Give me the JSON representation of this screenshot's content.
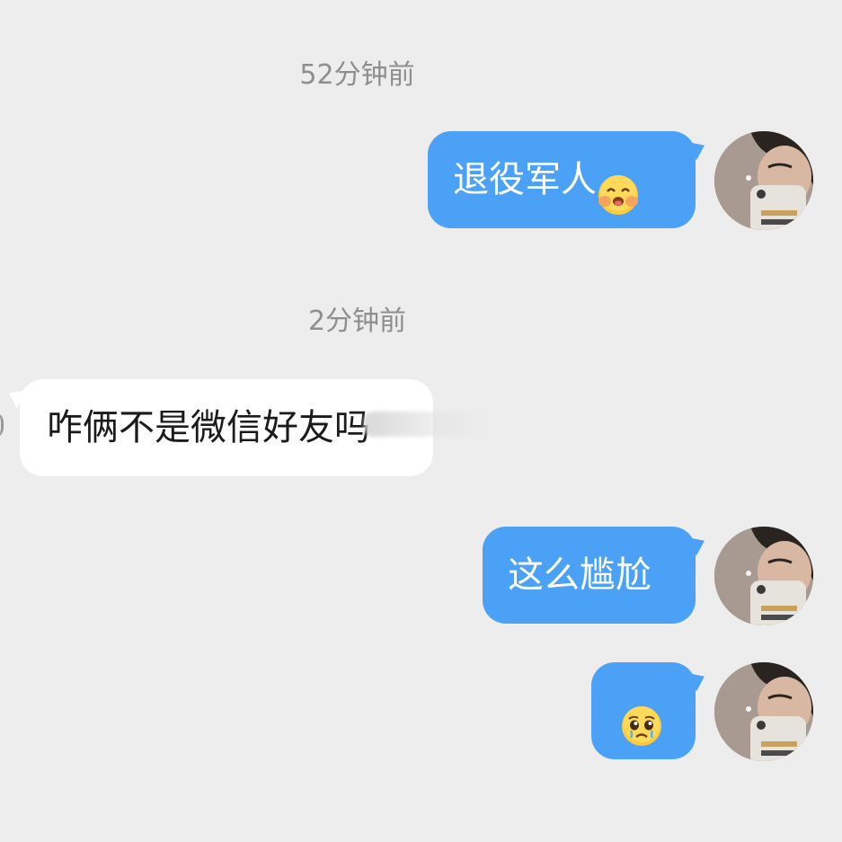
{
  "messages": [
    {
      "kind": "timestamp",
      "text": "52分钟前"
    },
    {
      "kind": "sent",
      "text": "退役军人",
      "emoji": "blushing-face-emoji"
    },
    {
      "kind": "timestamp",
      "text": "2分钟前"
    },
    {
      "kind": "received",
      "text": "咋俩不是微信好友吗"
    },
    {
      "kind": "sent",
      "text": "这么尴尬"
    },
    {
      "kind": "sent",
      "text": "",
      "emoji": "pleading-face-emoji"
    }
  ],
  "colors": {
    "background": "#ededed",
    "sent_bubble": "#4aa1f5",
    "received_bubble": "#ffffff",
    "timestamp": "#8e8e8e"
  },
  "avatar": {
    "icon": "user-avatar-icon"
  }
}
